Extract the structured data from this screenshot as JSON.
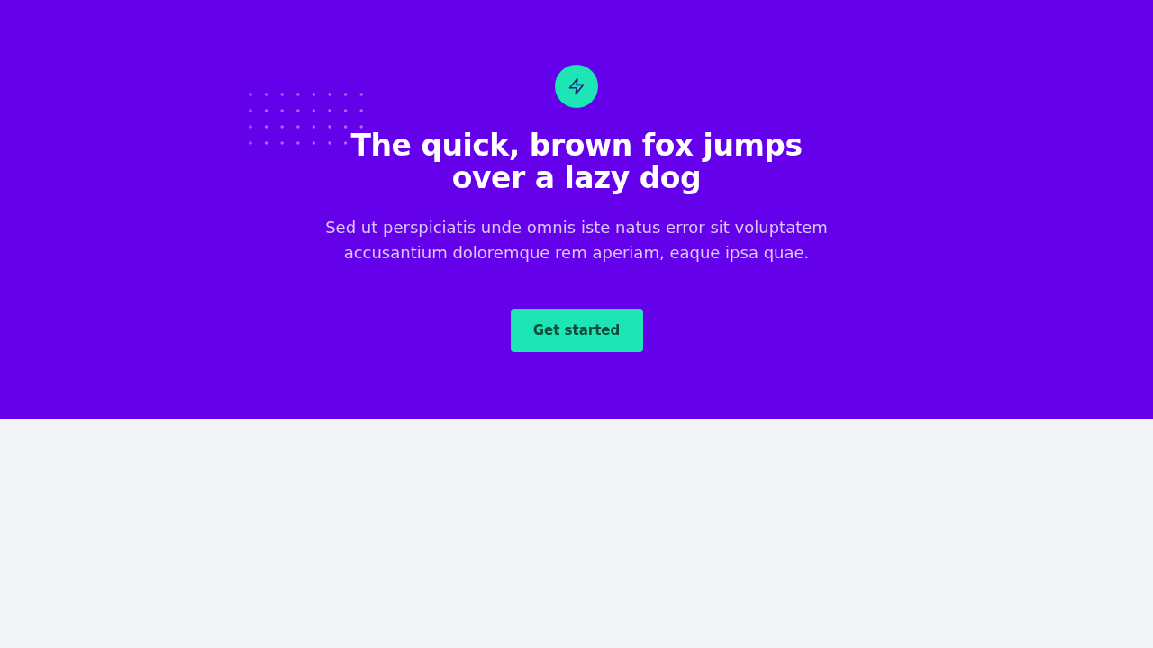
{
  "hero": {
    "title": "The quick, brown fox jumps over a lazy dog",
    "text": "Sed ut perspiciatis unde omnis iste natus error sit voluptatem accusantium doloremque rem aperiam, eaque ipsa quae.",
    "button": "Get started"
  }
}
